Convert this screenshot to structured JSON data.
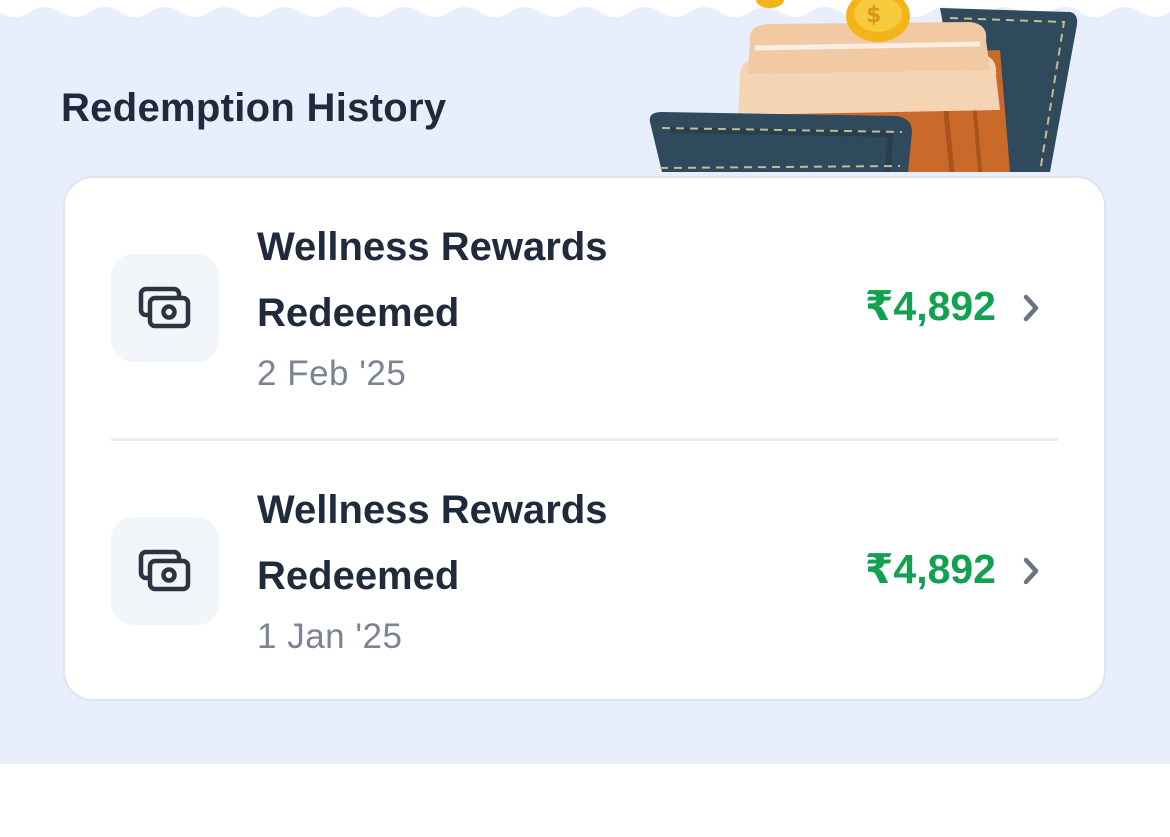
{
  "section": {
    "title": "Redemption History"
  },
  "history": {
    "items": [
      {
        "title": "Wellness Rewards Redeemed",
        "date": "2 Feb '25",
        "amount": "₹4,892",
        "icon": "cash-icon"
      },
      {
        "title": "Wellness Rewards Redeemed",
        "date": "1 Jan '25",
        "amount": "₹4,892",
        "icon": "cash-icon"
      }
    ]
  },
  "colors": {
    "panel_background": "#e8eefc",
    "amount": "#12a150",
    "title_text": "#1f2a3c",
    "secondary_text": "#7c8494"
  }
}
